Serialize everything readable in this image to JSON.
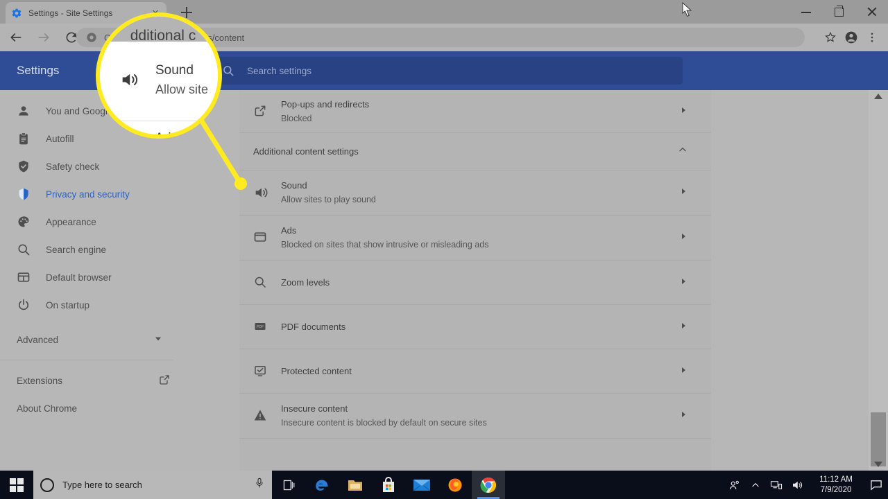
{
  "browser": {
    "tab": {
      "title": "Settings - Site Settings",
      "favicon": "gear-icon",
      "close": "close-icon"
    },
    "new_tab_label": "+",
    "omnibox": {
      "url": "Chrome | chrome://settings/content",
      "visible_tail": "gs/content",
      "icon": "chrome-icon"
    },
    "window_controls": {
      "minimize": "minimize-icon",
      "maximize": "maximize-icon",
      "close": "close-icon"
    },
    "toolbar_icons": [
      "back-icon",
      "forward-icon",
      "reload-icon",
      "bookmark-star-icon",
      "profile-icon",
      "more-menu-icon"
    ]
  },
  "settings": {
    "title": "Settings",
    "search": {
      "placeholder": "Search settings",
      "icon": "search-icon"
    },
    "sidebar": {
      "items": [
        {
          "label": "You and Google",
          "icon": "person-icon",
          "active": false
        },
        {
          "label": "Autofill",
          "icon": "clipboard-icon",
          "active": false
        },
        {
          "label": "Safety check",
          "icon": "shield-check-icon",
          "active": false
        },
        {
          "label": "Privacy and security",
          "icon": "shield-icon",
          "active": true
        },
        {
          "label": "Appearance",
          "icon": "palette-icon",
          "active": false
        },
        {
          "label": "Search engine",
          "icon": "search-icon",
          "active": false
        },
        {
          "label": "Default browser",
          "icon": "browser-window-icon",
          "active": false
        },
        {
          "label": "On startup",
          "icon": "power-icon",
          "active": false
        }
      ],
      "advanced": {
        "label": "Advanced",
        "icon": "chevron-down-icon"
      },
      "footer": [
        {
          "label": "Extensions",
          "icon": "external-link-icon"
        },
        {
          "label": "About Chrome",
          "icon": ""
        }
      ]
    },
    "content": {
      "rows": [
        {
          "title": "Pop-ups and redirects",
          "subtitle": "Blocked",
          "icon": "external-link-icon",
          "arrow": "chevron-right-icon"
        }
      ],
      "section_header": {
        "label": "Additional content settings",
        "icon": "chevron-up-icon"
      },
      "section_rows": [
        {
          "title": "Sound",
          "subtitle": "Allow sites to play sound",
          "icon": "speaker-icon",
          "arrow": "chevron-right-icon"
        },
        {
          "title": "Ads",
          "subtitle": "Blocked on sites that show intrusive or misleading ads",
          "icon": "window-icon",
          "arrow": "chevron-right-icon"
        },
        {
          "title": "Zoom levels",
          "subtitle": "",
          "icon": "search-icon",
          "arrow": "chevron-right-icon"
        },
        {
          "title": "PDF documents",
          "subtitle": "",
          "icon": "pdf-icon",
          "arrow": "chevron-right-icon"
        },
        {
          "title": "Protected content",
          "subtitle": "",
          "icon": "checkbox-monitor-icon",
          "arrow": "chevron-right-icon"
        },
        {
          "title": "Insecure content",
          "subtitle": "Insecure content is blocked by default on secure sites",
          "icon": "warning-icon",
          "arrow": "chevron-right-icon"
        }
      ]
    }
  },
  "callout": {
    "top_text": "dditional c",
    "icon": "speaker-icon",
    "title": "Sound",
    "subtitle": "Allow site",
    "bottom_text": "Ad",
    "ring_color": "#ffeb1f",
    "dot_color": "#ffeb1f"
  },
  "taskbar": {
    "start": "windows-start-icon",
    "search": {
      "placeholder": "Type here to search",
      "circle_icon": "cortana-circle-icon",
      "mic_icon": "microphone-icon"
    },
    "apps": [
      {
        "name": "task-view-icon",
        "active": false
      },
      {
        "name": "edge-icon",
        "active": false
      },
      {
        "name": "file-explorer-icon",
        "active": false
      },
      {
        "name": "microsoft-store-icon",
        "active": false
      },
      {
        "name": "mail-icon",
        "active": false
      },
      {
        "name": "firefox-icon",
        "active": false
      },
      {
        "name": "chrome-icon",
        "active": true
      }
    ],
    "tray": [
      "people-icon",
      "show-hidden-icons-chevron",
      "network-icon",
      "volume-icon"
    ],
    "clock": {
      "time": "11:12 AM",
      "date": "7/9/2020"
    },
    "action_center": "action-center-icon"
  },
  "colors": {
    "settings_header": "#2e4d96",
    "accent_blue": "#2b63c4",
    "highlight_yellow": "#ffeb1f",
    "page_bg": "#b4b4b4"
  }
}
